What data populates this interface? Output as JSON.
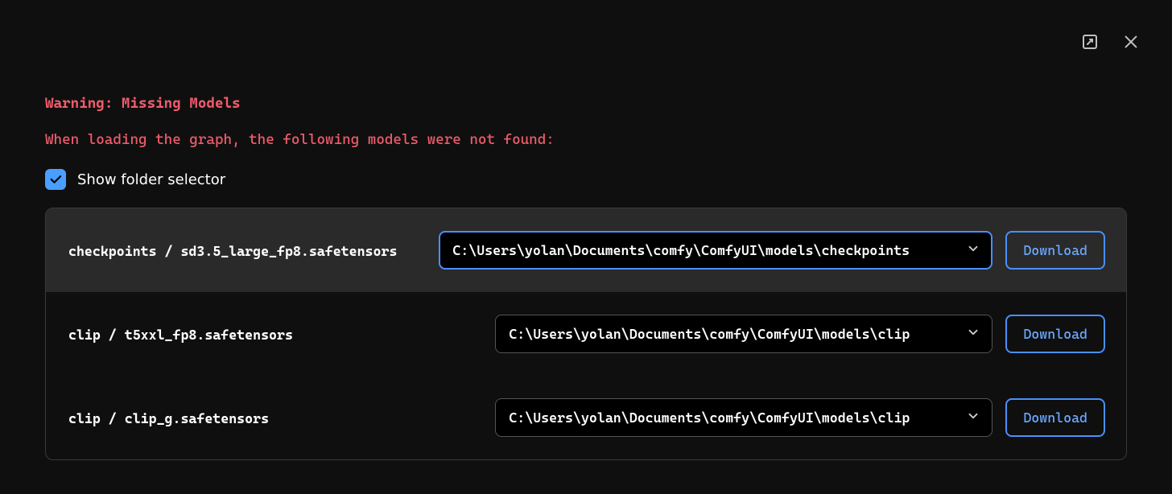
{
  "warning": {
    "title": "Warning: Missing Models",
    "subtitle": "When loading the graph, the following models were not found:"
  },
  "checkbox": {
    "label": "Show folder selector",
    "checked": true
  },
  "rows": [
    {
      "label": "checkpoints / sd3.5_large_fp8.safetensors",
      "path": "C:\\Users\\yolan\\Documents\\comfy\\ComfyUI\\models\\checkpoints",
      "download_label": "Download",
      "highlight": true,
      "focused": true
    },
    {
      "label": "clip / t5xxl_fp8.safetensors",
      "path": "C:\\Users\\yolan\\Documents\\comfy\\ComfyUI\\models\\clip",
      "download_label": "Download",
      "highlight": false,
      "focused": false
    },
    {
      "label": "clip / clip_g.safetensors",
      "path": "C:\\Users\\yolan\\Documents\\comfy\\ComfyUI\\models\\clip",
      "download_label": "Download",
      "highlight": false,
      "focused": false
    }
  ]
}
